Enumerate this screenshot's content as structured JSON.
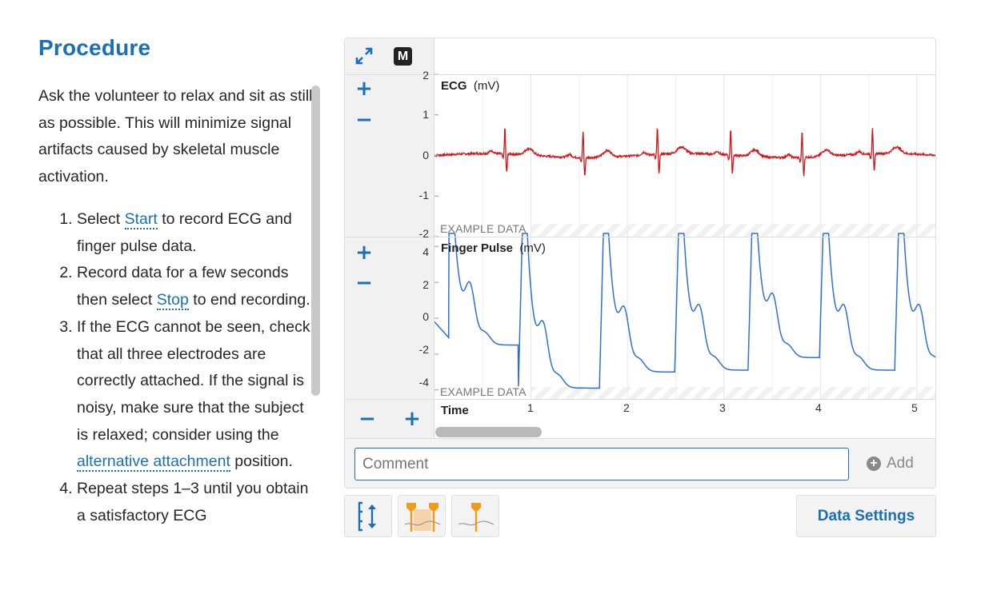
{
  "procedure": {
    "heading": "Procedure",
    "intro": "Ask the volunteer to relax and sit as still as possible. This will minimize signal artifacts caused by skeletal muscle activation.",
    "steps": [
      {
        "pre": "Select ",
        "link": "Start",
        "post": " to record ECG and finger pulse data."
      },
      {
        "pre": "Record data for a few seconds then select ",
        "link": "Stop",
        "post": " to end recording."
      },
      {
        "pre": "If the ECG cannot be seen, check that all three electrodes are correctly attached. If the signal is noisy, make sure that the subject is relaxed; consider using the ",
        "link": "alternative attachment",
        "post": " position."
      },
      {
        "pre": "Repeat steps 1–3 until you obtain a satisfactory ECG",
        "link": "",
        "post": ""
      }
    ]
  },
  "toolbar": {
    "expand_icon": "expand-arrows-icon",
    "marker_label": "M"
  },
  "charts": {
    "ecg": {
      "title": "ECG",
      "unit": "(mV)",
      "watermark": "EXAMPLE DATA",
      "yticks": [
        "2",
        "1",
        "0",
        "-1",
        "-2"
      ],
      "color": "#d0151b"
    },
    "pulse": {
      "title": "Finger Pulse",
      "unit": "(mV)",
      "watermark": "EXAMPLE DATA",
      "yticks": [
        "4",
        "2",
        "0",
        "-2",
        "-4"
      ],
      "color": "#2f6fd6"
    },
    "time": {
      "label": "Time",
      "ticks": [
        "1",
        "2",
        "3",
        "4",
        "5"
      ]
    }
  },
  "chart_data": [
    {
      "type": "line",
      "title": "ECG",
      "ylabel": "(mV)",
      "ylim": [
        -2,
        2
      ],
      "xlim": [
        0.0,
        5.2
      ],
      "series": [
        {
          "name": "ECG",
          "r_peaks_x": [
            0.73,
            1.54,
            2.31,
            3.07,
            3.81,
            4.54
          ],
          "baseline": 0.0,
          "r_amplitude": 0.65,
          "s_amplitude": -0.45
        }
      ]
    },
    {
      "type": "line",
      "title": "Finger Pulse",
      "ylabel": "(mV)",
      "ylim": [
        -4.5,
        4.5
      ],
      "xlim": [
        0.0,
        5.2
      ],
      "series": [
        {
          "name": "Finger Pulse",
          "upstroke_x": [
            0.93,
            1.77,
            2.55,
            3.31,
            4.05,
            4.83
          ],
          "trough_values": [
            -3.8,
            -3.9,
            -3.0,
            -2.9,
            -2.2,
            -2.9
          ]
        }
      ]
    }
  ],
  "comment": {
    "placeholder": "Comment",
    "add_label": "Add"
  },
  "bottom_buttons": {
    "autoscale_icon": "autoscale-icon",
    "two_point_icon": "two-marker-selection-icon",
    "one_point_icon": "single-marker-icon",
    "data_settings": "Data Settings"
  }
}
